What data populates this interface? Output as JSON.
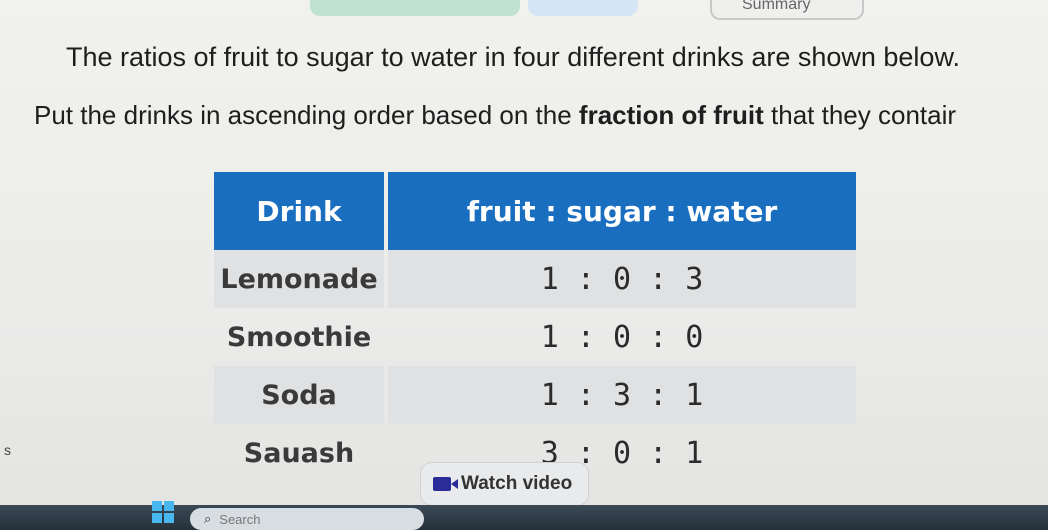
{
  "tabs": {
    "summary_label": "Summary"
  },
  "question": {
    "intro": "The ratios of fruit to sugar to water in four different drinks are shown below.",
    "instruction_prefix": "Put the drinks in ascending order based on the ",
    "instruction_bold": "fraction of fruit",
    "instruction_suffix": " that they contair"
  },
  "table": {
    "headers": [
      "Drink",
      "fruit : sugar : water"
    ],
    "rows": [
      {
        "drink": "Lemonade",
        "ratio": "1 : 0 : 3"
      },
      {
        "drink": "Smoothie",
        "ratio": "1 : 0 : 0"
      },
      {
        "drink": "Soda",
        "ratio": "1 : 3 : 1"
      },
      {
        "drink": "Sauash",
        "ratio": "3 : 0 : 1"
      }
    ]
  },
  "left_edge_char": "s",
  "watch_video": {
    "label": "Watch video",
    "icon": "video-camera-icon"
  },
  "taskbar": {
    "search_placeholder": "Search",
    "start_icon": "windows-start-icon",
    "search_icon": "search-icon"
  },
  "colors": {
    "header_blue": "#1a6ec0",
    "row_shade": "#dfe1e2"
  }
}
